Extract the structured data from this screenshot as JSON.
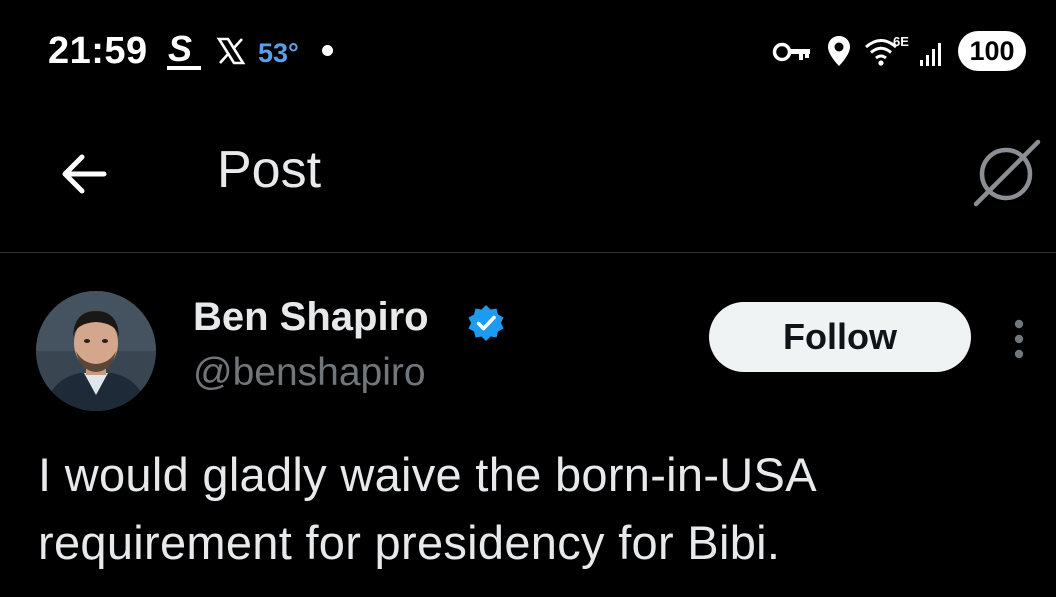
{
  "status_bar": {
    "time": "21:59",
    "weather": "53°",
    "battery": "100",
    "icons": [
      "s-app-icon",
      "x-app-icon",
      "notification-dot",
      "vpn-key-icon",
      "location-icon",
      "wifi-6e-icon",
      "cellular-signal-icon"
    ],
    "weather_color": "#5aa0e8"
  },
  "header": {
    "title": "Post",
    "back_icon": "arrow-left-icon",
    "grok_icon": "grok-icon"
  },
  "post": {
    "author_name": "Ben Shapiro",
    "handle": "@benshapiro",
    "follow_label": "Follow",
    "text": "I would gladly waive the born-in-USA requirement for presidency for Bibi.",
    "verified_color": "#1d9bf0"
  },
  "colors": {
    "background": "#000000",
    "text_primary": "#e7e9ea",
    "text_secondary": "#71767b",
    "divider": "#2f3336"
  }
}
